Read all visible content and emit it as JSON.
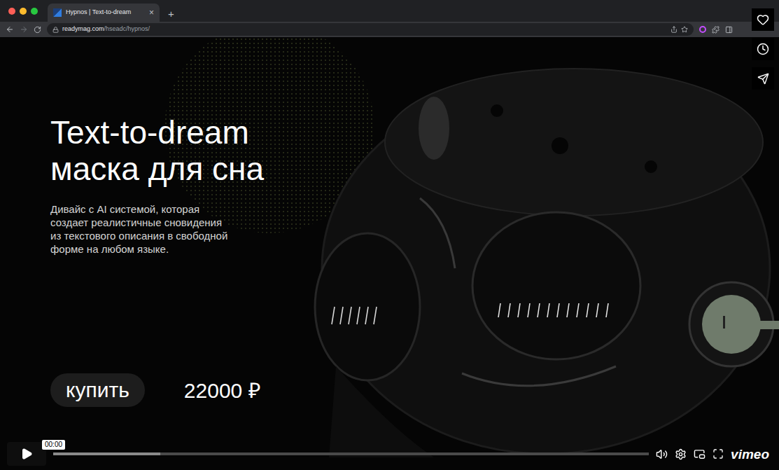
{
  "browser": {
    "tab": {
      "title": "Hypnos | Text-to-dream",
      "close": "×"
    },
    "new_tab": "+",
    "url": {
      "host": "readymag.com",
      "path": "/hseadc/hypnos/"
    }
  },
  "page": {
    "title_lines": [
      "Text-to-dream",
      "маска для сна"
    ],
    "description_lines": [
      "Дивайс с AI системой, которая",
      "создает реалистичные сновидения",
      "из текстового описания в свободной",
      "форме на любом языке."
    ],
    "buy_button": "купить",
    "price": "22000 ₽"
  },
  "player": {
    "playing": false,
    "time_tooltip": "00:00",
    "level": 0,
    "buffered": 0.18,
    "logo": "vimeo"
  }
}
